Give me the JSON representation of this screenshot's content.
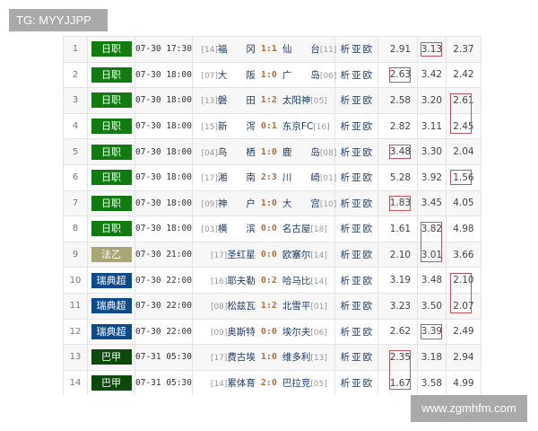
{
  "watermark": "TG: MYYJJPP",
  "site": "www.zgmhfm.com",
  "colors": {
    "日职": "#117a11",
    "法乙": "#a9a675",
    "瑞典超": "#0d4a8a",
    "巴甲": "#0b4a0b",
    "highlight": "#c8525a"
  },
  "links": [
    "析",
    "亚",
    "欧"
  ],
  "rows": [
    {
      "no": "1",
      "league": "日职",
      "time": "07-30 17:30",
      "home_rank": "[14]",
      "home": "福　　冈",
      "score": "1:1",
      "away": "仙　　台",
      "away_rank": "[11]",
      "odds": [
        "2.91",
        "3.13",
        "2.37"
      ]
    },
    {
      "no": "2",
      "league": "日职",
      "time": "07-30 18:00",
      "home_rank": "[07]",
      "home": "大　　阪",
      "score": "1:0",
      "away": "广　　岛",
      "away_rank": "[06]",
      "odds": [
        "2.63",
        "3.42",
        "2.42"
      ]
    },
    {
      "no": "3",
      "league": "日职",
      "time": "07-30 18:00",
      "home_rank": "[13]",
      "home": "磐　　田",
      "score": "1:2",
      "away": "太阳神",
      "away_rank": "[05]",
      "odds": [
        "2.58",
        "3.20",
        "2.61"
      ]
    },
    {
      "no": "4",
      "league": "日职",
      "time": "07-30 18:00",
      "home_rank": "[15]",
      "home": "新　　泻",
      "score": "0:1",
      "away": "东京FC",
      "away_rank": "[16]",
      "odds": [
        "2.82",
        "3.11",
        "2.45"
      ]
    },
    {
      "no": "5",
      "league": "日职",
      "time": "07-30 18:00",
      "home_rank": "[04]",
      "home": "鸟　　栖",
      "score": "1:0",
      "away": "鹿　　岛",
      "away_rank": "[08]",
      "odds": [
        "3.48",
        "3.30",
        "2.04"
      ]
    },
    {
      "no": "6",
      "league": "日职",
      "time": "07-30 18:00",
      "home_rank": "[17]",
      "home": "湘　　南",
      "score": "2:3",
      "away": "川　　崎",
      "away_rank": "[01]",
      "odds": [
        "5.28",
        "3.92",
        "1.56"
      ]
    },
    {
      "no": "7",
      "league": "日职",
      "time": "07-30 18:00",
      "home_rank": "[09]",
      "home": "神　　户",
      "score": "1:0",
      "away": "大　　宫",
      "away_rank": "[10]",
      "odds": [
        "1.83",
        "3.45",
        "4.05"
      ]
    },
    {
      "no": "8",
      "league": "日职",
      "time": "07-30 18:00",
      "home_rank": "[03]",
      "home": "横　　滨",
      "score": "0:0",
      "away": "名古屋",
      "away_rank": "[18]",
      "odds": [
        "1.61",
        "3.82",
        "4.98"
      ]
    },
    {
      "no": "9",
      "league": "法乙",
      "time": "07-30 21:00",
      "home_rank": "[17]",
      "home": "圣红星",
      "score": "0:0",
      "away": "欧塞尔",
      "away_rank": "[14]",
      "odds": [
        "2.10",
        "3.01",
        "3.66"
      ]
    },
    {
      "no": "10",
      "league": "瑞典超",
      "time": "07-30 22:00",
      "home_rank": "[16]",
      "home": "耶夫勒",
      "score": "0:2",
      "away": "哈马比",
      "away_rank": "[14]",
      "odds": [
        "3.19",
        "3.48",
        "2.10"
      ]
    },
    {
      "no": "11",
      "league": "瑞典超",
      "time": "07-30 22:00",
      "home_rank": "[08]",
      "home": "松兹瓦",
      "score": "1:2",
      "away": "北雪平",
      "away_rank": "[01]",
      "odds": [
        "3.23",
        "3.50",
        "2.07"
      ]
    },
    {
      "no": "12",
      "league": "瑞典超",
      "time": "07-30 22:00",
      "home_rank": "[09]",
      "home": "奥斯特",
      "score": "0:0",
      "away": "埃尔夫",
      "away_rank": "[06]",
      "odds": [
        "2.62",
        "3.39",
        "2.49"
      ]
    },
    {
      "no": "13",
      "league": "巴甲",
      "time": "07-31 05:30",
      "home_rank": "[17]",
      "home": "费古埃",
      "score": "1:0",
      "away": "维多利",
      "away_rank": "[13]",
      "odds": [
        "2.35",
        "3.18",
        "2.94"
      ]
    },
    {
      "no": "14",
      "league": "巴甲",
      "time": "07-31 05:30",
      "home_rank": "[14]",
      "home": "累体育",
      "score": "2:0",
      "away": "巴拉竞",
      "away_rank": "[05]",
      "odds": [
        "1.67",
        "3.58",
        "4.99"
      ]
    }
  ],
  "highlights": [
    {
      "col": 1,
      "from": 1,
      "to": 1
    },
    {
      "col": 0,
      "from": 2,
      "to": 2
    },
    {
      "col": 2,
      "from": 3,
      "to": 4
    },
    {
      "col": 0,
      "from": 5,
      "to": 5
    },
    {
      "col": 2,
      "from": 6,
      "to": 6
    },
    {
      "col": 0,
      "from": 7,
      "to": 7
    },
    {
      "col": 1,
      "from": 8,
      "to": 9
    },
    {
      "col": 2,
      "from": 10,
      "to": 11
    },
    {
      "col": 1,
      "from": 12,
      "to": 12
    },
    {
      "col": 0,
      "from": 13,
      "to": 14
    }
  ]
}
